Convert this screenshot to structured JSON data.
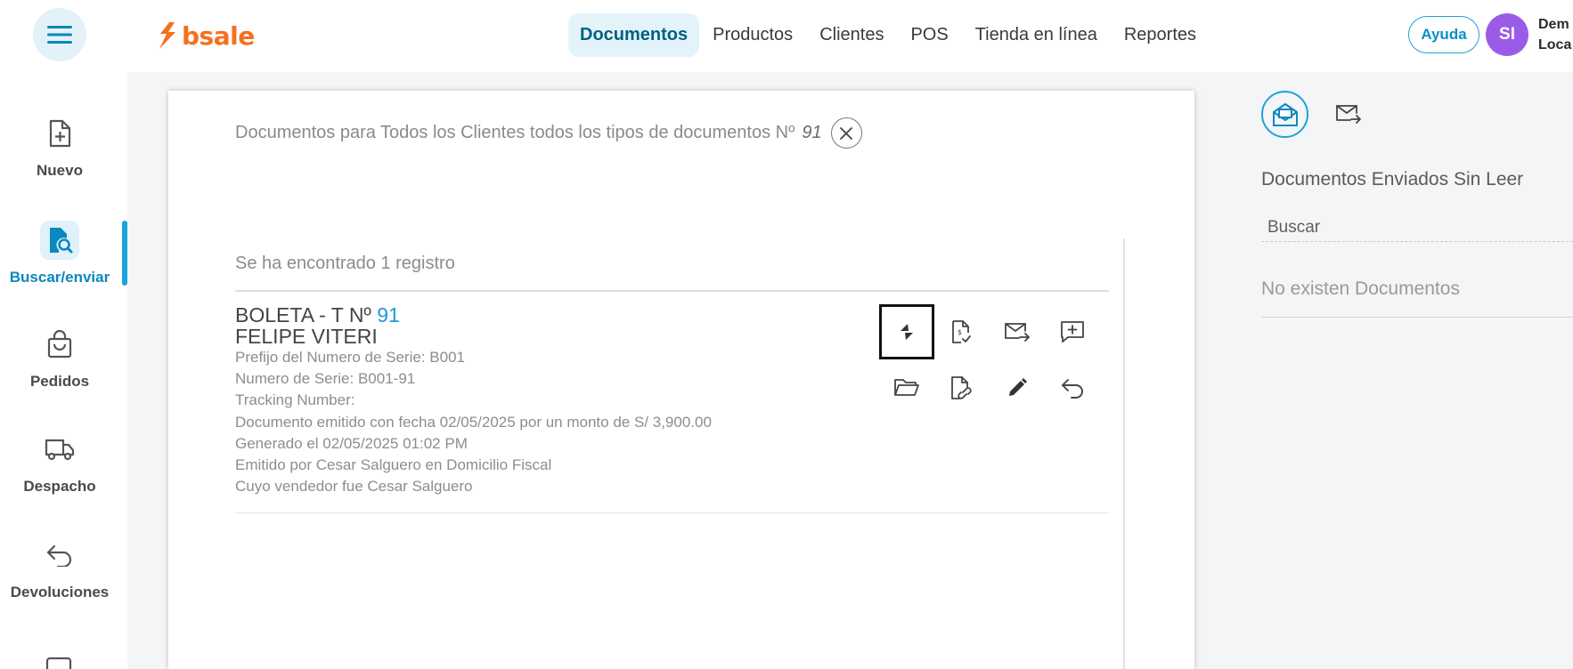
{
  "brand": {
    "name": "bsale",
    "color": "#f4711f"
  },
  "header": {
    "nav": [
      {
        "label": "Documentos",
        "active": true
      },
      {
        "label": "Productos",
        "active": false
      },
      {
        "label": "Clientes",
        "active": false
      },
      {
        "label": "POS",
        "active": false
      },
      {
        "label": "Tienda en línea",
        "active": false
      },
      {
        "label": "Reportes",
        "active": false
      }
    ],
    "help_label": "Ayuda",
    "avatar_initials": "SI",
    "user_line1": "Dem",
    "user_line2": "Loca"
  },
  "sidebar": {
    "items": [
      {
        "label": "Nuevo",
        "icon": "file-plus-icon"
      },
      {
        "label": "Buscar/enviar",
        "icon": "file-search-icon",
        "active": true
      },
      {
        "label": "Pedidos",
        "icon": "shopping-bag-icon"
      },
      {
        "label": "Despacho",
        "icon": "truck-icon"
      },
      {
        "label": "Devoluciones",
        "icon": "return-arrow-icon"
      }
    ]
  },
  "search_card": {
    "title_prefix": "Documentos para Todos los Clientes todos los tipos de documentos Nº",
    "title_number": "91",
    "found_text": "Se ha encontrado 1 registro",
    "document": {
      "type_label": "BOLETA - T Nº",
      "number": "91",
      "client": "FELIPE VITERI",
      "lines": [
        "Prefijo del Numero de Serie: B001",
        "Numero de Serie: B001-91",
        "Tracking Number:",
        "Documento emitido con fecha 02/05/2025 por un monto de S/ 3,900.00",
        "Generado el 02/05/2025 01:02 PM",
        "Emitido por Cesar Salguero en Domicilio Fiscal",
        "Cuyo vendedor fue Cesar Salguero"
      ],
      "actions": [
        "payment-icon",
        "file-check-icon",
        "email-send-icon",
        "comment-add-icon",
        "folder-open-icon",
        "file-link-icon",
        "pencil-icon",
        "undo-icon"
      ]
    }
  },
  "right_panel": {
    "heading": "Documentos Enviados Sin Leer",
    "search_placeholder": "Buscar",
    "empty_text": "No existen Documentos"
  },
  "colors": {
    "accent": "#1aa3dc",
    "active_nav_bg": "#e4f3fa",
    "avatar": "#9a5ce8"
  }
}
